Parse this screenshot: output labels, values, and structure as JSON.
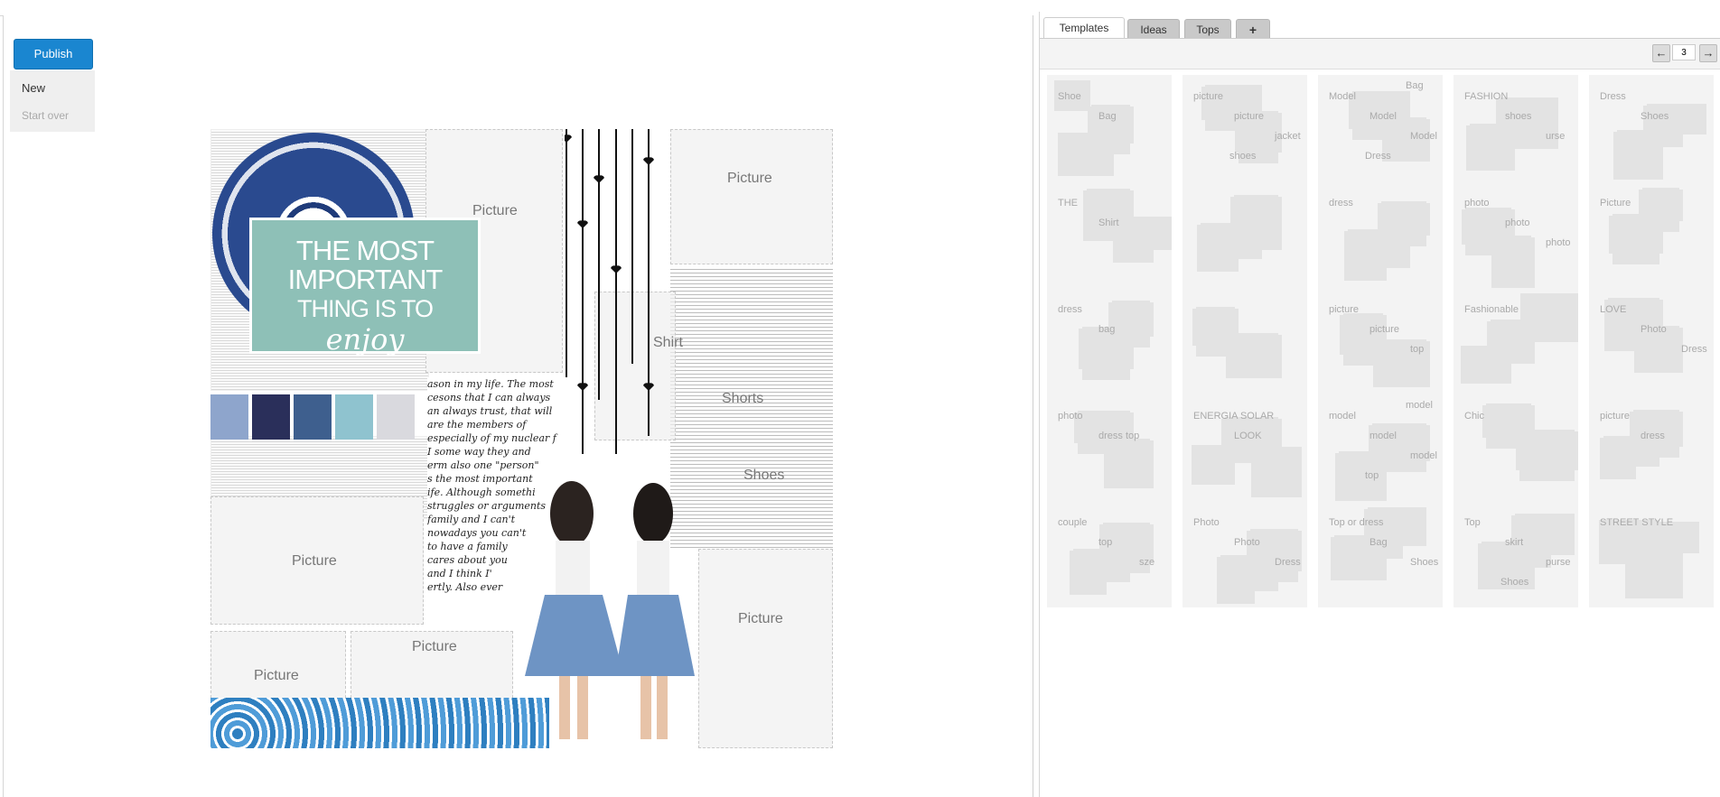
{
  "editor": {
    "buttons": {
      "publish": "Publish",
      "new": "New",
      "start_over": "Start over"
    },
    "canvas": {
      "banner_line1": "THE MOST",
      "banner_line2": "IMPORTANT",
      "banner_line3": "THING IS TO",
      "banner_line4": "enjoy",
      "slot_labels": {
        "picture_top_mid": "Picture",
        "picture_top_right": "Picture",
        "shirt": "Shirt",
        "shorts": "Shorts",
        "shoes": "Shoes",
        "picture_mid_left": "Picture",
        "picture_bottom_mid": "Picture",
        "picture_bottom_left": "Picture",
        "picture_bottom_right": "Picture"
      },
      "handwriting_lines": [
        "ason in my life. The most",
        "cesons that I can always",
        "an always trust, that will",
        "are the members of",
        "especially of my nuclear f",
        "I some way they and",
        "erm also one \"person\"",
        "s the most important",
        "ife. Although somethi",
        "struggles or arguments",
        "family and I can't",
        "nowadays you can't",
        "to have a family",
        "cares about you",
        "and I think I'",
        "ertly. Also ever"
      ],
      "swatch_colors": [
        "#8ea5cc",
        "#2a2f5a",
        "#3e5f8e",
        "#8fc3cf",
        "#d9d9de"
      ]
    }
  },
  "panel": {
    "tabs": [
      "Templates",
      "Ideas",
      "Tops",
      "+"
    ],
    "active_tab": "Templates",
    "pager": {
      "prev_icon": "arrow-left-icon",
      "page": "3",
      "next_icon": "arrow-right-icon"
    },
    "thumbnails": [
      {
        "labels": [
          "Shoe",
          "Bag"
        ]
      },
      {
        "labels": [
          "picture",
          "picture",
          "jacket",
          "shoes"
        ]
      },
      {
        "labels": [
          "Model",
          "Model",
          "Model",
          "Dress",
          "Bag"
        ]
      },
      {
        "labels": [
          "FASHION",
          "shoes",
          "urse"
        ]
      },
      {
        "labels": [
          "Dress",
          "Shoes"
        ]
      },
      {
        "labels": [
          "THE",
          "Shirt"
        ]
      },
      {
        "labels": []
      },
      {
        "labels": [
          "dress"
        ]
      },
      {
        "labels": [
          "photo",
          "photo",
          "photo"
        ]
      },
      {
        "labels": [
          "Picture"
        ]
      },
      {
        "labels": [
          "dress",
          "bag"
        ]
      },
      {
        "labels": []
      },
      {
        "labels": [
          "picture",
          "picture",
          "top"
        ]
      },
      {
        "labels": [
          "Fashionable"
        ]
      },
      {
        "labels": [
          "LOVE",
          "Photo",
          "Dress"
        ]
      },
      {
        "labels": [
          "photo",
          "dress top"
        ]
      },
      {
        "labels": [
          "ENERGIA SOLAR",
          "LOOK"
        ]
      },
      {
        "labels": [
          "model",
          "model",
          "model",
          "top",
          "model"
        ]
      },
      {
        "labels": [
          "Chic"
        ]
      },
      {
        "labels": [
          "picture",
          "dress"
        ]
      },
      {
        "labels": [
          "couple",
          "top",
          "sze"
        ]
      },
      {
        "labels": [
          "Photo",
          "Photo",
          "Dress"
        ]
      },
      {
        "labels": [
          "Top or dress",
          "Bag",
          "Shoes"
        ]
      },
      {
        "labels": [
          "Top",
          "skirt",
          "purse",
          "Shoes"
        ]
      },
      {
        "labels": [
          "STREET STYLE"
        ]
      }
    ]
  }
}
